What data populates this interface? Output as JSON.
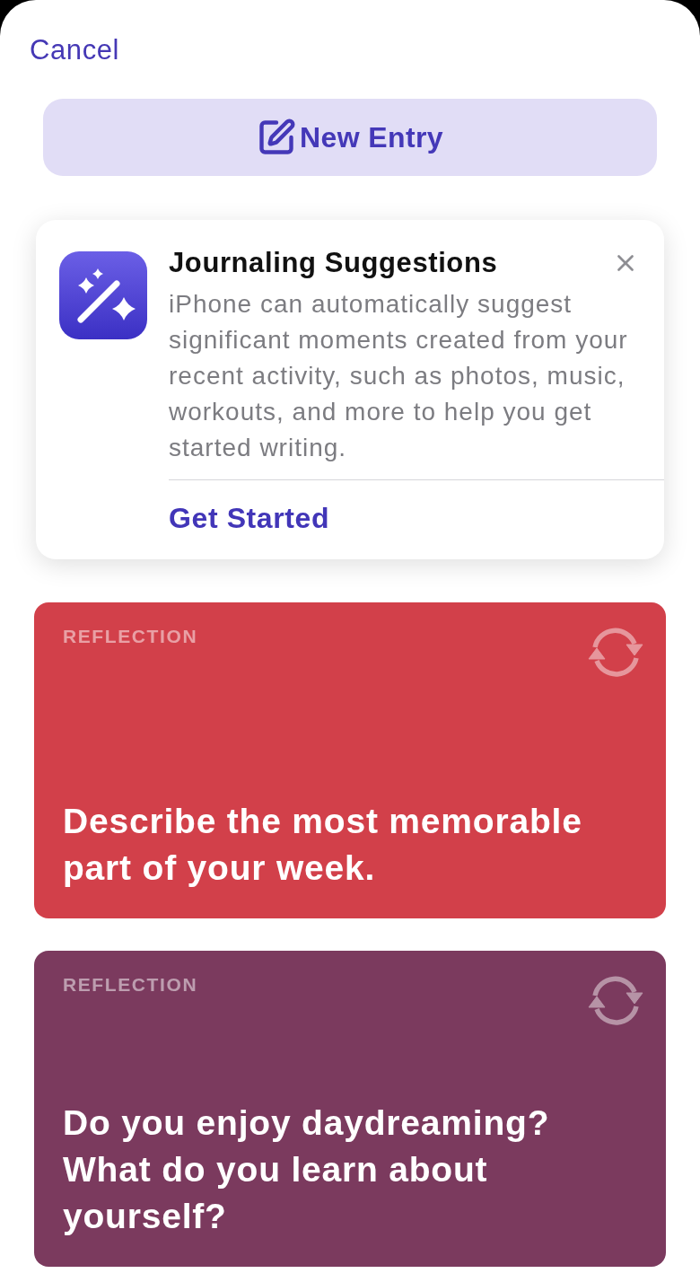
{
  "cancel": "Cancel",
  "new_entry_button": {
    "label": "New Entry"
  },
  "suggestion_card": {
    "title": "Journaling Suggestions",
    "body": "iPhone can automatically suggest significant moments created from your recent activity, such as photos, music, workouts, and more to help you get started writing.",
    "action": "Get Started"
  },
  "prompts": [
    {
      "category": "REFLECTION",
      "text": "Describe the most memorable part of your week.",
      "color": "#d2404a"
    },
    {
      "category": "REFLECTION",
      "text": "Do you enjoy daydreaming? What do you learn about yourself?",
      "color": "#7b3a5e"
    }
  ]
}
